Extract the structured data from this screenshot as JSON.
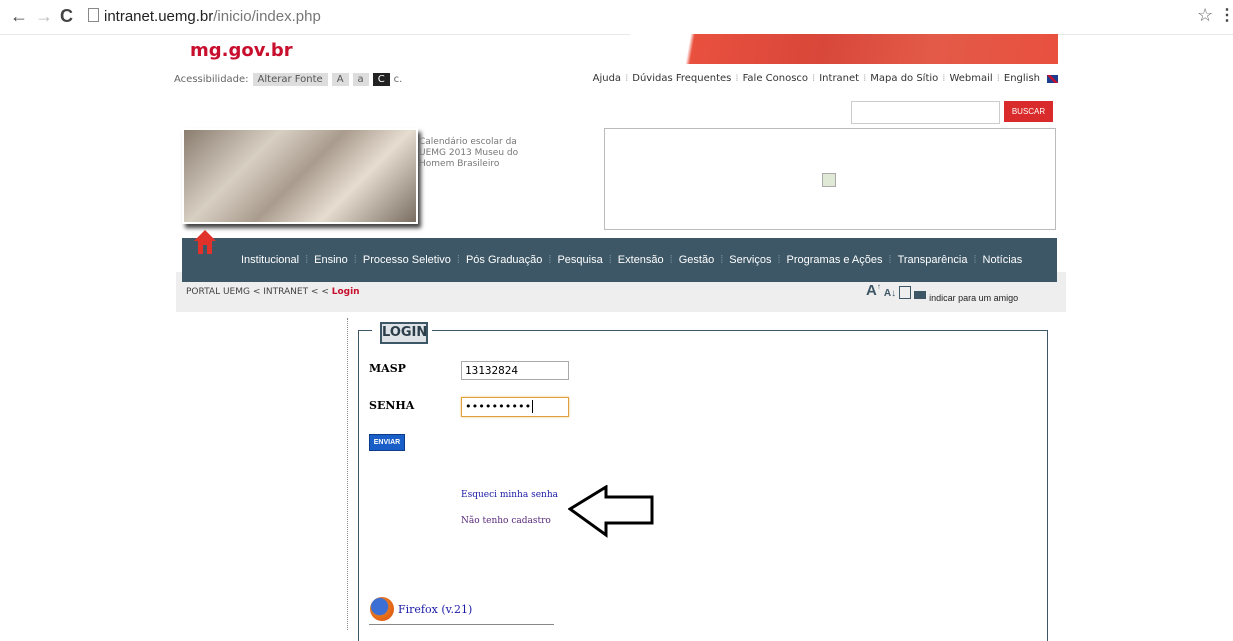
{
  "browser": {
    "back_icon": "←",
    "forward_icon": "→",
    "reload_icon": "C",
    "url_host": "intranet.uemg.br",
    "url_path": "/inicio/index.php",
    "star_icon": "☆",
    "menu_icon": "⋮"
  },
  "header": {
    "logo": "mg.gov.br",
    "accessibility_label": "Acessibilidade:",
    "alterar_fonte": "Alterar Fonte",
    "font_big": "A",
    "font_small": "a",
    "contrast": "C",
    "contrast_light": "c.",
    "top_links": [
      "Ajuda",
      "Dúvidas Frequentes",
      "Fale Conosco",
      "Intranet",
      "Mapa do Sítio",
      "Webmail",
      "English"
    ],
    "search_button": "BUSCAR"
  },
  "banner": {
    "caption": "Calendário escolar da UEMG 2013 Museu do Homem Brasileiro"
  },
  "menu": {
    "items": [
      "Institucional",
      "Ensino",
      "Processo Seletivo",
      "Pós Graduação",
      "Pesquisa",
      "Extensão",
      "Gestão",
      "Serviços",
      "Programas e Ações",
      "Transparência",
      "Notícias"
    ]
  },
  "breadcrumb": {
    "path": "PORTAL UEMG < INTRANET < < ",
    "current": "Login"
  },
  "tools": {
    "increase_font": "A",
    "decrease_font": "A",
    "indicate_friend": "indicar para um amigo"
  },
  "login": {
    "title": "LOGIN",
    "masp_label": "MASP",
    "masp_value": "13132824",
    "senha_label": "SENHA",
    "senha_value": "••••••••••",
    "send_button": "ENVIAR",
    "forgot_link": "Esqueci minha senha",
    "no_account_link": "Não tenho cadastro",
    "firefox_link": "Firefox (v.21)"
  }
}
